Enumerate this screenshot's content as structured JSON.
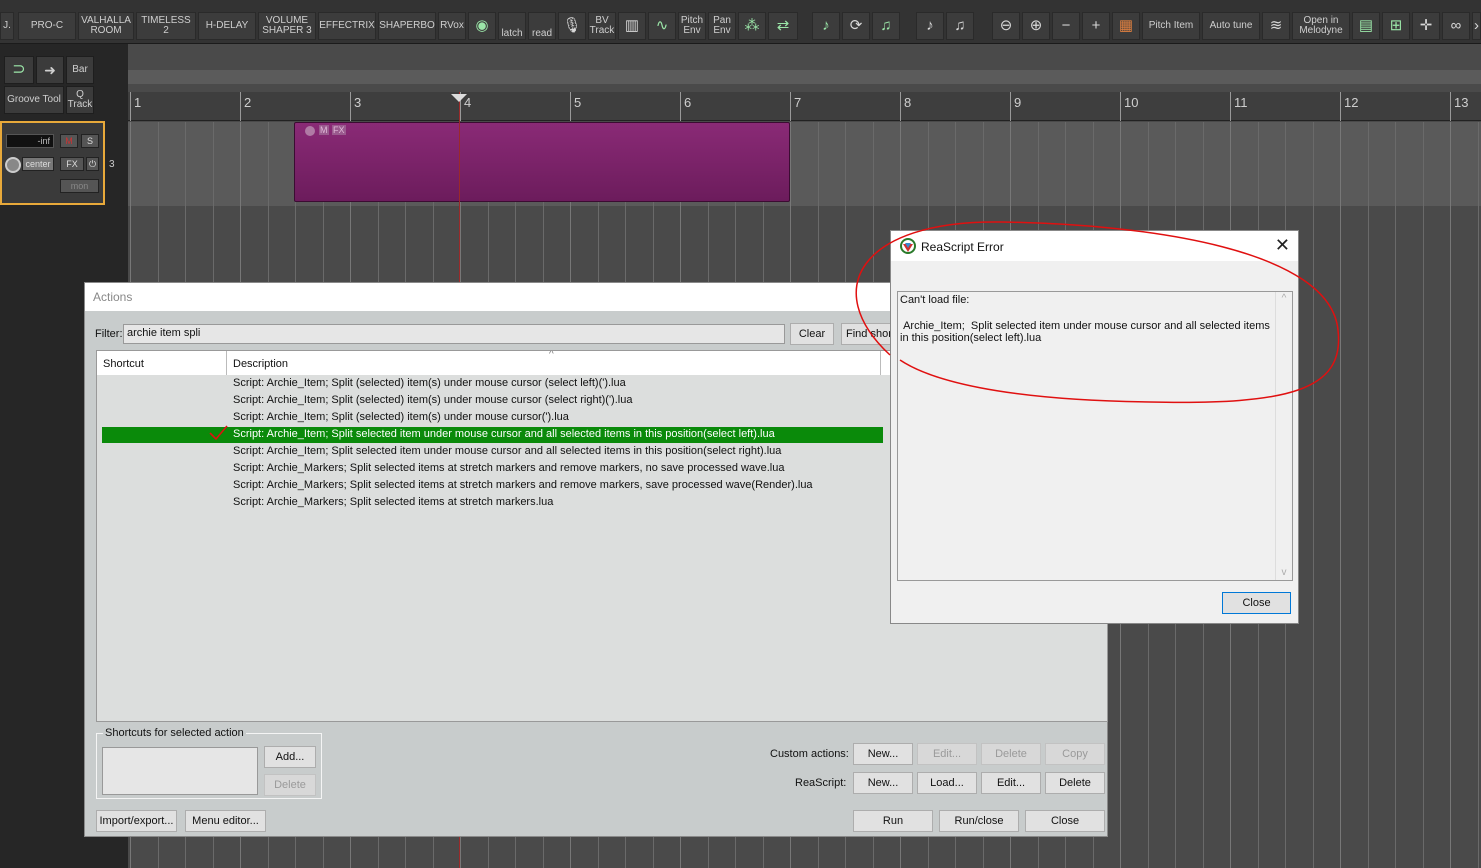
{
  "toolbar": {
    "buttons": [
      {
        "label": "J."
      },
      {
        "label": "PRO-C"
      },
      {
        "label": "VALHALLA\nROOM"
      },
      {
        "label": "TIMELESS\n2"
      },
      {
        "label": "H-DELAY"
      },
      {
        "label": "VOLUME\nSHAPER 3"
      },
      {
        "label": "EFFECTRIX"
      },
      {
        "label": "SHAPERBO"
      },
      {
        "label": "RVox"
      },
      {
        "label": "latch"
      },
      {
        "label": "read"
      },
      {
        "label": "BV\nTrack"
      },
      {
        "label": "Pitch\nEnv"
      },
      {
        "label": "Pan\nEnv"
      },
      {
        "label": "Pitch Item"
      },
      {
        "label": "Auto tune"
      },
      {
        "label": "Open in\nMelodyne"
      }
    ]
  },
  "side": {
    "bar_label": "Bar",
    "groove_label": "Groove Tool",
    "qtrack_label": "Q\nTrack",
    "meter_value": "-inf",
    "m_label": "M",
    "s_label": "S",
    "pan_value": "center",
    "fx_label": "FX",
    "track_number": "3",
    "input_label": "mon"
  },
  "ruler": {
    "numbers": [
      "1",
      "2",
      "3",
      "4",
      "5",
      "6",
      "7",
      "8",
      "9",
      "10",
      "11",
      "12",
      "13"
    ]
  },
  "media_item": {
    "badges": [
      "M",
      "FX"
    ]
  },
  "actions": {
    "title": "Actions",
    "filter_label": "Filter:",
    "filter_value": "archie item spli",
    "clear_label": "Clear",
    "find_shortcut_label": "Find short",
    "col_shortcut": "Shortcut",
    "col_description": "Description",
    "rows": [
      "Script: Archie_Item;  Split (selected) item(s) under mouse cursor (select left)(').lua",
      "Script: Archie_Item;  Split (selected) item(s) under mouse cursor (select right)(').lua",
      "Script: Archie_Item;  Split (selected) item(s) under mouse cursor(').lua",
      "Script: Archie_Item;  Split selected item under mouse cursor and all selected items in this position(select left).lua",
      "Script: Archie_Item;  Split selected item under mouse cursor and all selected items in this position(select right).lua",
      "Script: Archie_Markers;  Split selected items at stretch markers and remove markers, no save processed wave.lua",
      "Script: Archie_Markers;  Split selected items at stretch markers and remove markers, save processed wave(Render).lua",
      "Script: Archie_Markers;  Split selected items at stretch markers.lua"
    ],
    "selected_index": 3,
    "shortcuts_group": "Shortcuts for selected action",
    "add_label": "Add...",
    "delete_label": "Delete",
    "custom_actions_label": "Custom actions:",
    "reascript_label": "ReaScript:",
    "new_label": "New...",
    "edit_label": "Edit...",
    "copy_label": "Copy",
    "load_label": "Load...",
    "import_export_label": "Import/export...",
    "menu_editor_label": "Menu editor...",
    "run_label": "Run",
    "run_close_label": "Run/close",
    "close_label": "Close"
  },
  "error": {
    "title": "ReaScript Error",
    "line1": "Can't load file:",
    "line2": " Archie_Item;  Split selected item under mouse cursor and all selected items in this position(select left).lua",
    "close_label": "Close"
  },
  "colors": {
    "accent_selection": "#0a8a0a",
    "annotation": "#e01010",
    "item": "#7a2368"
  }
}
